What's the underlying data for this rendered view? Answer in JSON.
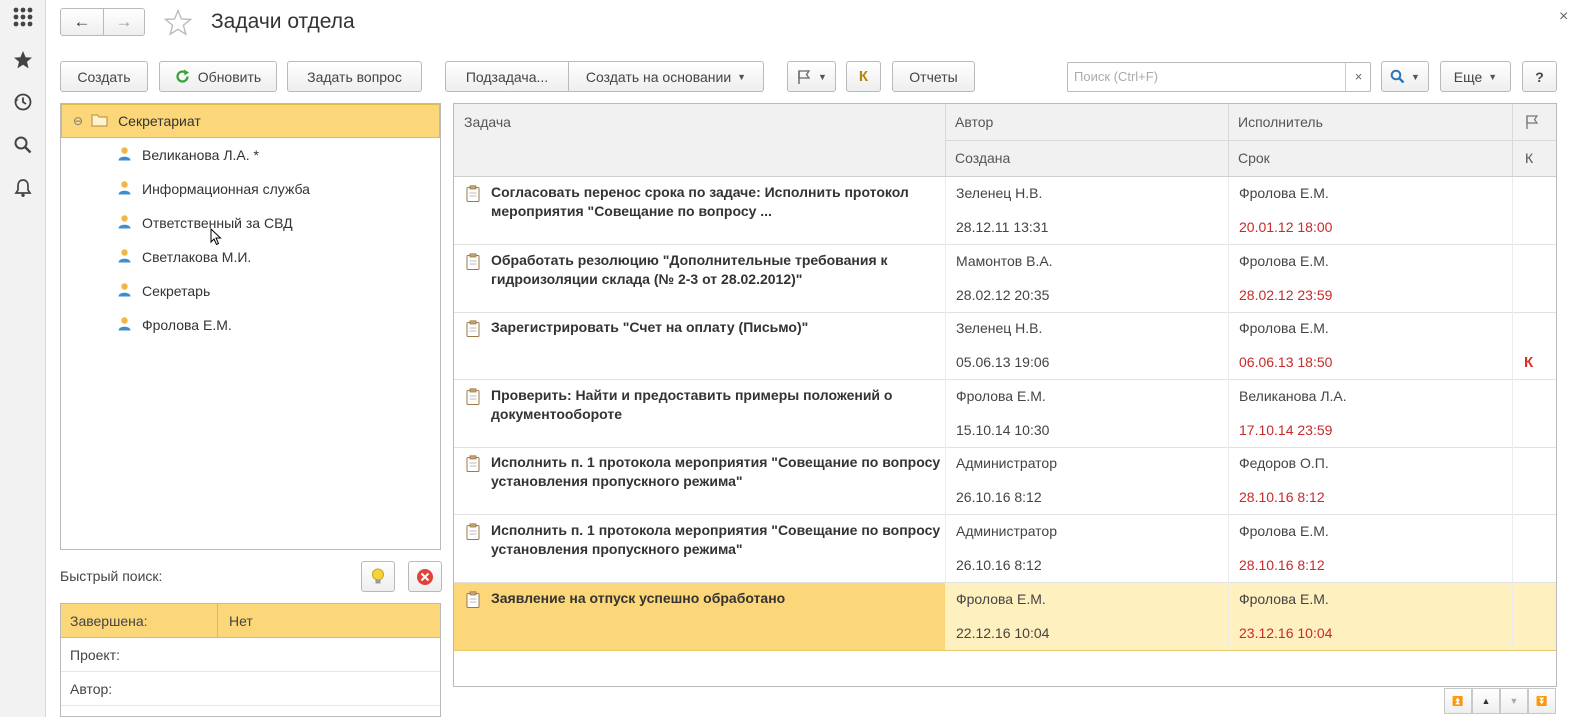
{
  "window": {
    "title": "Задачи отдела",
    "close_glyph": "×"
  },
  "nav": {
    "back_icon": "←",
    "forward_icon": "→"
  },
  "toolbar": {
    "create": "Создать",
    "refresh": "Обновить",
    "ask_question": "Задать вопрос",
    "subtask": "Подзадача...",
    "create_based_on": "Создать на основании",
    "flag_caret": "▼",
    "k_label": "К",
    "reports": "Отчеты",
    "more": "Еще",
    "help": "?"
  },
  "search": {
    "placeholder": "Поиск (Ctrl+F)",
    "clear_glyph": "×"
  },
  "tree": {
    "root": "Секретариат",
    "collapse_glyph": "⊖",
    "items": [
      "Великанова Л.А. *",
      "Информационная служба",
      "Ответственный за СВД",
      "Светлакова М.И.",
      "Секретарь",
      "Фролова Е.М."
    ]
  },
  "quick_search": {
    "label": "Быстрый поиск:",
    "rows": [
      {
        "field": "Завершена:",
        "value": "Нет"
      },
      {
        "field": "Проект:",
        "value": ""
      },
      {
        "field": "Автор:",
        "value": ""
      }
    ]
  },
  "grid": {
    "headers": {
      "task": "Задача",
      "author": "Автор",
      "created": "Создана",
      "executor": "Исполнитель",
      "deadline": "Срок",
      "k": "К"
    },
    "rows": [
      {
        "task": "Согласовать перенос срока по задаче: Исполнить протокол мероприятия \"Совещание по вопросу ...",
        "author": "Зеленец Н.В.",
        "created": "28.12.11 13:31",
        "executor": "Фролова Е.М.",
        "deadline": "20.01.12 18:00",
        "k": ""
      },
      {
        "task": "Обработать резолюцию \"Дополнительные требования к гидроизоляции склада (№ 2-3 от 28.02.2012)\"",
        "author": "Мамонтов В.А.",
        "created": "28.02.12 20:35",
        "executor": "Фролова Е.М.",
        "deadline": "28.02.12 23:59",
        "k": ""
      },
      {
        "task": "Зарегистрировать \"Счет на оплату (Письмо)\"",
        "author": "Зеленец Н.В.",
        "created": "05.06.13 19:06",
        "executor": "Фролова Е.М.",
        "deadline": "06.06.13 18:50",
        "k": "К"
      },
      {
        "task": "Проверить: Найти и предоставить примеры положений о документообороте",
        "author": "Фролова Е.М.",
        "created": "15.10.14 10:30",
        "executor": "Великанова Л.А.",
        "deadline": "17.10.14 23:59",
        "k": ""
      },
      {
        "task": "Исполнить п. 1 протокола мероприятия \"Совещание по вопросу установления пропускного режима\"",
        "author": "Администратор",
        "created": "26.10.16 8:12",
        "executor": "Федоров О.П.",
        "deadline": "28.10.16 8:12",
        "k": ""
      },
      {
        "task": "Исполнить п. 1 протокола мероприятия \"Совещание по вопросу установления пропускного режима\"",
        "author": "Администратор",
        "created": "26.10.16 8:12",
        "executor": "Фролова Е.М.",
        "deadline": "28.10.16 8:12",
        "k": ""
      },
      {
        "task": "Заявление на отпуск успешно обработано",
        "author": "Фролова Е.М.",
        "created": "22.12.16 10:04",
        "executor": "Фролова Е.М.",
        "deadline": "23.12.16 10:04",
        "k": ""
      }
    ],
    "selected_row": 6
  },
  "colors": {
    "selection": "#fbd779",
    "overdue": "#c62a2a",
    "refresh_green": "#3aa13a"
  }
}
